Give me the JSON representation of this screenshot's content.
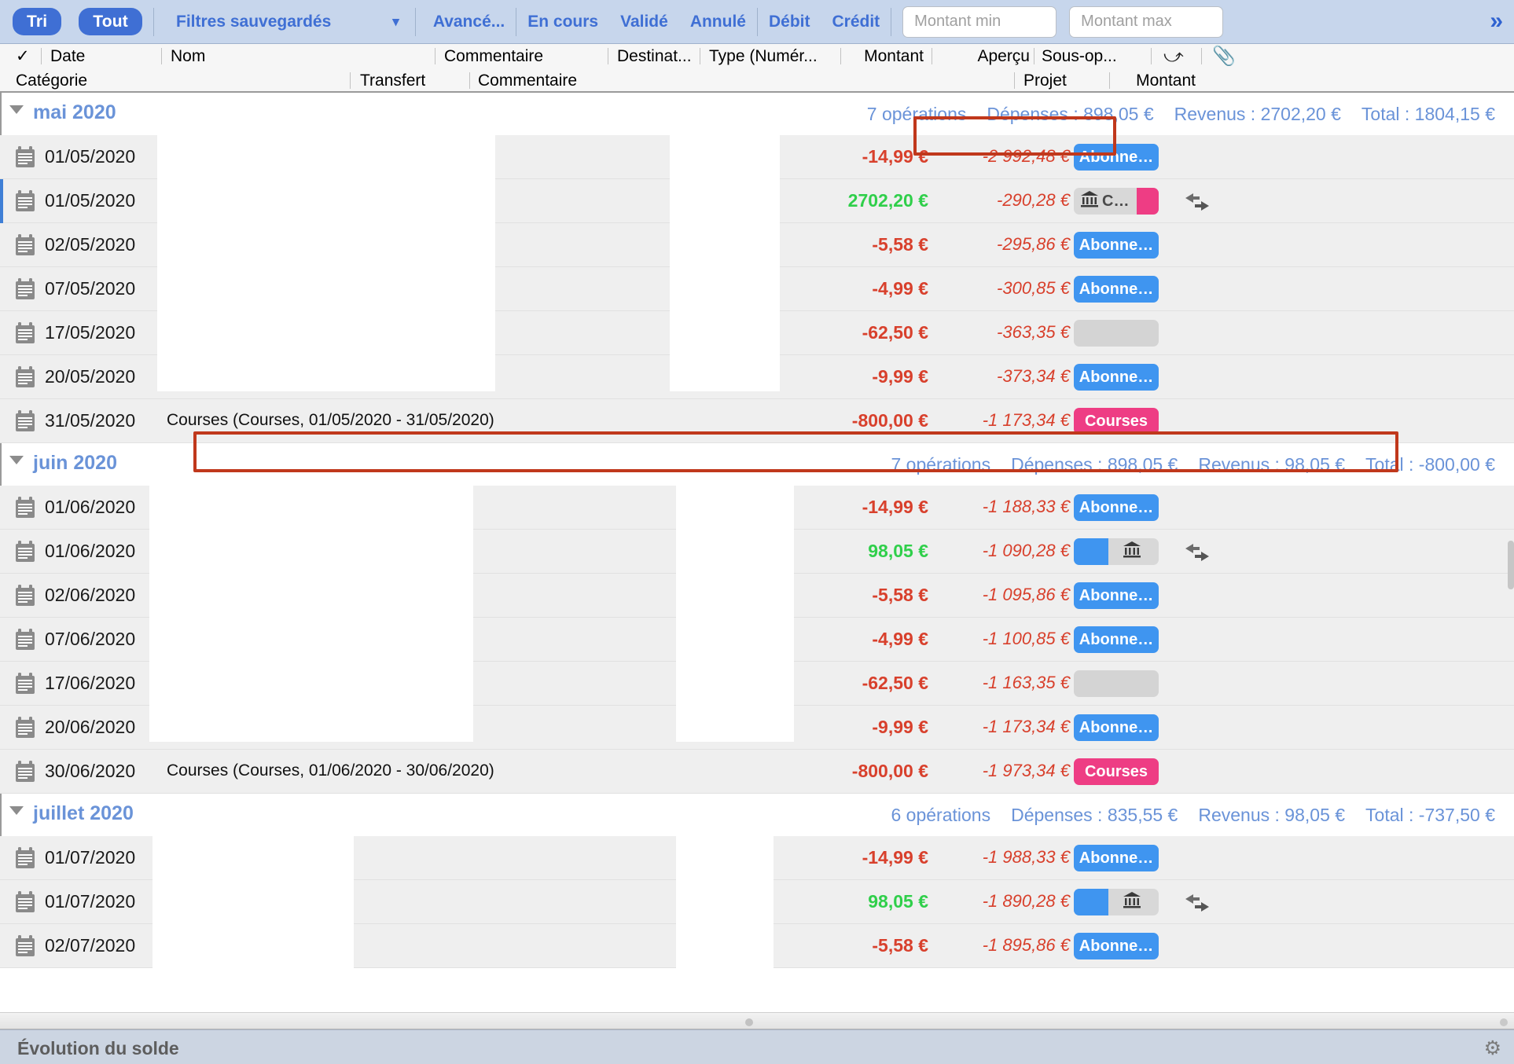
{
  "toolbar": {
    "sort_label": "Tri",
    "all_label": "Tout",
    "saved_filters_label": "Filtres sauvegardés",
    "saved_filters_chevron": "chevron-down-icon",
    "advanced_label": "Avancé...",
    "pending_label": "En cours",
    "validated_label": "Validé",
    "cancelled_label": "Annulé",
    "debit_label": "Débit",
    "credit_label": "Crédit",
    "amount_min_placeholder": "Montant min",
    "amount_min_value": "",
    "amount_max_placeholder": "Montant max",
    "amount_max_value": "",
    "expand_label": "»"
  },
  "columns": {
    "row1": {
      "check": "✓",
      "date": "Date",
      "name": "Nom",
      "comment": "Commentaire",
      "destination": "Destinat...",
      "type": "Type (Numér...",
      "amount": "Montant",
      "preview": "Aperçu",
      "suboperation": "Sous-op...",
      "transfer_icon": "transfer-arrows-icon",
      "attachment_icon": "paperclip-icon"
    },
    "row2": {
      "category": "Catégorie",
      "transfer": "Transfert",
      "comment": "Commentaire",
      "project": "Projet",
      "amount": "Montant"
    }
  },
  "groups": [
    {
      "name": "mai 2020",
      "operations": "7 opérations",
      "expenses": "Dépenses : 898,05 €",
      "revenues": "Revenus : 2702,20 €",
      "total": "Total : 1804,15 €",
      "rows": [
        {
          "date": "01/05/2020",
          "name": "",
          "amount": "-14,99 €",
          "amount_sign": "neg",
          "balance": "-2 992,48 €",
          "tag": "Abonne…",
          "tag_style": "blue",
          "transfer": false,
          "selected": false
        },
        {
          "date": "01/05/2020",
          "name": "",
          "amount": "2702,20 €",
          "amount_sign": "pos",
          "balance": "-290,28 €",
          "tag": "C…",
          "tag_style": "split",
          "transfer": true,
          "selected": true
        },
        {
          "date": "02/05/2020",
          "name": "",
          "amount": "-5,58 €",
          "amount_sign": "neg",
          "balance": "-295,86 €",
          "tag": "Abonne…",
          "tag_style": "blue",
          "transfer": false,
          "selected": false
        },
        {
          "date": "07/05/2020",
          "name": "",
          "amount": "-4,99 €",
          "amount_sign": "neg",
          "balance": "-300,85 €",
          "tag": "Abonne…",
          "tag_style": "blue",
          "transfer": false,
          "selected": false
        },
        {
          "date": "17/05/2020",
          "name": "",
          "amount": "-62,50 €",
          "amount_sign": "neg",
          "balance": "-363,35 €",
          "tag": "",
          "tag_style": "gray",
          "transfer": false,
          "selected": false
        },
        {
          "date": "20/05/2020",
          "name": "",
          "amount": "-9,99 €",
          "amount_sign": "neg",
          "balance": "-373,34 €",
          "tag": "Abonne…",
          "tag_style": "blue",
          "transfer": false,
          "selected": false
        },
        {
          "date": "31/05/2020",
          "name": "Courses (Courses, 01/05/2020 - 31/05/2020)",
          "amount": "-800,00 €",
          "amount_sign": "neg",
          "balance": "-1 173,34 €",
          "tag": "Courses",
          "tag_style": "pink",
          "transfer": false,
          "selected": false
        }
      ]
    },
    {
      "name": "juin 2020",
      "operations": "7 opérations",
      "expenses": "Dépenses : 898,05 €",
      "revenues": "Revenus : 98,05 €",
      "total": "Total : -800,00 €",
      "rows": [
        {
          "date": "01/06/2020",
          "name": "",
          "amount": "-14,99 €",
          "amount_sign": "neg",
          "balance": "-1 188,33 €",
          "tag": "Abonne…",
          "tag_style": "blue",
          "transfer": false,
          "selected": false
        },
        {
          "date": "01/06/2020",
          "name": "",
          "amount": "98,05 €",
          "amount_sign": "pos",
          "balance": "-1 090,28 €",
          "tag": "",
          "tag_style": "split2",
          "transfer": true,
          "selected": false
        },
        {
          "date": "02/06/2020",
          "name": "",
          "amount": "-5,58 €",
          "amount_sign": "neg",
          "balance": "-1 095,86 €",
          "tag": "Abonne…",
          "tag_style": "blue",
          "transfer": false,
          "selected": false
        },
        {
          "date": "07/06/2020",
          "name": "",
          "amount": "-4,99 €",
          "amount_sign": "neg",
          "balance": "-1 100,85 €",
          "tag": "Abonne…",
          "tag_style": "blue",
          "transfer": false,
          "selected": false
        },
        {
          "date": "17/06/2020",
          "name": "",
          "amount": "-62,50 €",
          "amount_sign": "neg",
          "balance": "-1 163,35 €",
          "tag": "",
          "tag_style": "gray",
          "transfer": false,
          "selected": false
        },
        {
          "date": "20/06/2020",
          "name": "",
          "amount": "-9,99 €",
          "amount_sign": "neg",
          "balance": "-1 173,34 €",
          "tag": "Abonne…",
          "tag_style": "blue",
          "transfer": false,
          "selected": false
        },
        {
          "date": "30/06/2020",
          "name": "Courses (Courses, 01/06/2020 - 30/06/2020)",
          "amount": "-800,00 €",
          "amount_sign": "neg",
          "balance": "-1 973,34 €",
          "tag": "Courses",
          "tag_style": "pink",
          "transfer": false,
          "selected": false
        }
      ]
    },
    {
      "name": "juillet 2020",
      "operations": "6 opérations",
      "expenses": "Dépenses : 835,55 €",
      "revenues": "Revenus : 98,05 €",
      "total": "Total : -737,50 €",
      "rows": [
        {
          "date": "01/07/2020",
          "name": "",
          "amount": "-14,99 €",
          "amount_sign": "neg",
          "balance": "-1 988,33 €",
          "tag": "Abonne…",
          "tag_style": "blue",
          "transfer": false,
          "selected": false
        },
        {
          "date": "01/07/2020",
          "name": "",
          "amount": "98,05 €",
          "amount_sign": "pos",
          "balance": "-1 890,28 €",
          "tag": "",
          "tag_style": "split2",
          "transfer": true,
          "selected": false
        },
        {
          "date": "02/07/2020",
          "name": "",
          "amount": "-5,58 €",
          "amount_sign": "neg",
          "balance": "-1 895,86 €",
          "tag": "Abonne…",
          "tag_style": "blue",
          "transfer": false,
          "selected": false
        }
      ]
    }
  ],
  "statusbar": {
    "label": "Évolution du solde",
    "gear_icon": "gear-icon"
  },
  "highlights": {
    "expenses_box_color": "#c0381c",
    "courses_row_box_color": "#c0381c"
  }
}
